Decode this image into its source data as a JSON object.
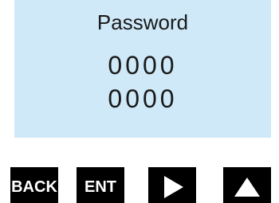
{
  "screen": {
    "title": "Password",
    "line1": "0000",
    "line2": "0000",
    "background_color": "#cfe9f8"
  },
  "keys": {
    "back_label": "BACK",
    "ent_label": "ENT",
    "right_icon": "triangle-right-icon",
    "up_icon": "triangle-up-icon",
    "key_color": "#000000"
  }
}
